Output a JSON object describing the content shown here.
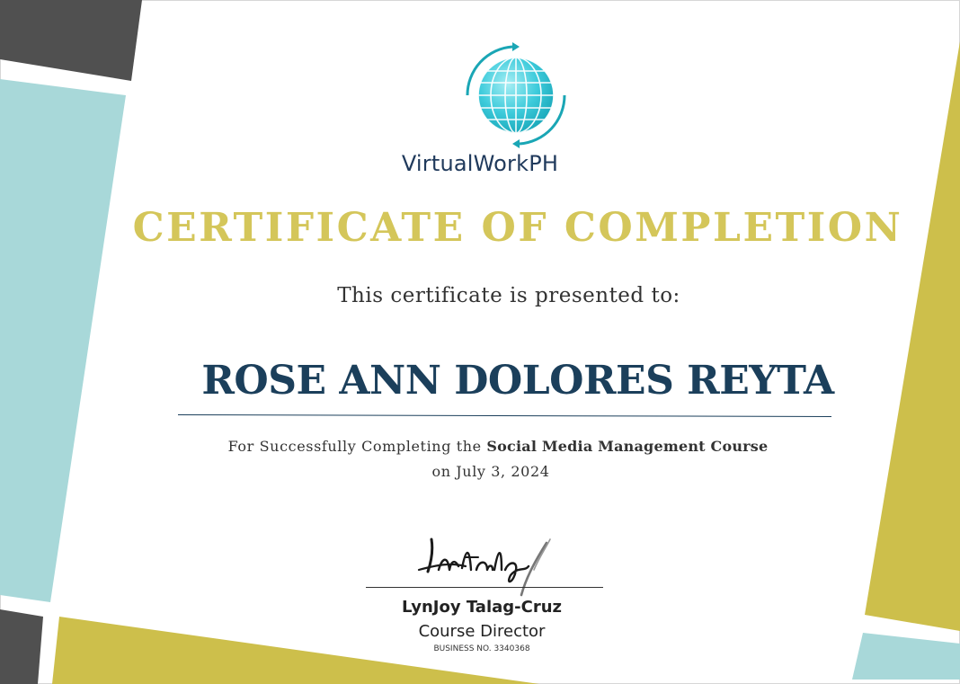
{
  "brand": {
    "name": "VirtualWorkPH",
    "logo_icon": "globe-arrows-icon"
  },
  "certificate": {
    "title": "CERTIFICATE OF COMPLETION",
    "presented_to": "This certificate is presented to:",
    "recipient": "ROSE ANN DOLORES REYTA",
    "description_prefix": "For Successfully Completing the ",
    "course": "Social Media Management Course",
    "date_line": "on July 3, 2024"
  },
  "signatory": {
    "signature_icon": "handwritten-signature",
    "name": "LynJoy Talag-Cruz",
    "role": "Course Director",
    "business_no": "BUSINESS NO. 3340368"
  },
  "colors": {
    "gold": "#d4c65a",
    "navy": "#1b3f5b",
    "teal_light": "#a8d8d9",
    "charcoal": "#505050",
    "olive": "#cdbf4b",
    "globe": "#2bbfd0"
  }
}
